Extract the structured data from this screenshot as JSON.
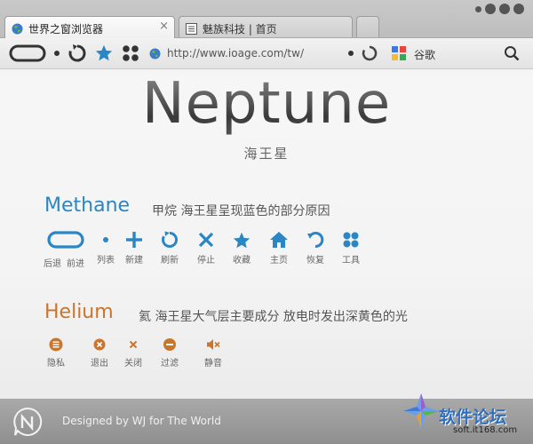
{
  "tabs": [
    {
      "title": "世界之窗浏览器",
      "close": "×",
      "icon": "globe-icon"
    },
    {
      "title": "魅族科技 | 首页",
      "icon": "page-icon"
    }
  ],
  "toolbar": {
    "url": "http://www.ioage.com/tw/",
    "search_engine": "谷歌"
  },
  "hero": {
    "title": "Neptune",
    "subtitle": "海王星"
  },
  "methane": {
    "title": "Methane",
    "description": "甲烷 海王星呈现蓝色的部分原因",
    "icons": [
      {
        "label": "后退",
        "icon": "back-icon"
      },
      {
        "label": "前进",
        "icon": "forward-icon"
      },
      {
        "label": "列表",
        "icon": "list-icon"
      },
      {
        "label": "新建",
        "icon": "plus-icon"
      },
      {
        "label": "刷新",
        "icon": "refresh-icon"
      },
      {
        "label": "停止",
        "icon": "stop-icon"
      },
      {
        "label": "收藏",
        "icon": "star-icon"
      },
      {
        "label": "主页",
        "icon": "home-icon"
      },
      {
        "label": "恢复",
        "icon": "restore-icon"
      },
      {
        "label": "工具",
        "icon": "tools-icon"
      }
    ]
  },
  "helium": {
    "title": "Helium",
    "description": "氦 海王星大气层主要成分 放电时发出深黄色的光",
    "icons": [
      {
        "label": "隐私",
        "icon": "privacy-icon"
      },
      {
        "label": "退出",
        "icon": "exit-icon"
      },
      {
        "label": "关闭",
        "icon": "close-icon"
      },
      {
        "label": "过滤",
        "icon": "filter-icon"
      },
      {
        "label": "静音",
        "icon": "mute-icon"
      }
    ]
  },
  "footer": {
    "text": "Designed by WJ for The World"
  },
  "watermark": {
    "text": "软件论坛",
    "url": "soft.it168.com"
  },
  "colors": {
    "blue": "#2a86c4",
    "orange": "#c9762c"
  }
}
